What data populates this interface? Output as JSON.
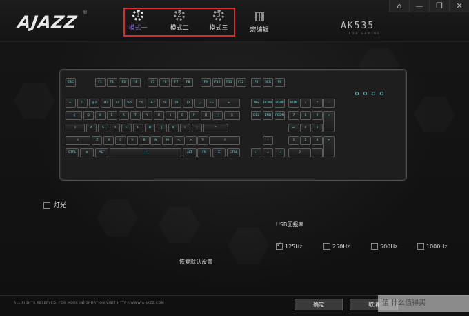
{
  "brand": {
    "logo": "AJAZZ",
    "reg": "®",
    "model": "AK535",
    "model_sub": "FOR GAMING"
  },
  "window_controls": [
    "⌂",
    "—",
    "❐",
    "✕"
  ],
  "modes": [
    {
      "num": "1",
      "label": "模式一",
      "active": true
    },
    {
      "num": "2",
      "label": "模式二",
      "active": false
    },
    {
      "num": "3",
      "label": "模式三",
      "active": false
    }
  ],
  "macro_label": "宏编辑",
  "keyboard": {
    "rows": [
      [
        "ESC",
        "F1",
        "F2",
        "F3",
        "F4",
        "F5",
        "F6",
        "F7",
        "F8",
        "F9",
        "F10",
        "F11",
        "F12",
        "PS",
        "SCR",
        "PB"
      ],
      [
        "~`",
        "!1",
        "@2",
        "#3",
        "$4",
        "%5",
        "^6",
        "&7",
        "*8",
        "(9",
        ")0",
        "_-",
        "+=",
        "←",
        "INS",
        "HOME",
        "PGUP",
        "NUM",
        "/",
        "*",
        "-"
      ],
      [
        "→|",
        "Q",
        "W",
        "E",
        "R",
        "T",
        "Y",
        "U",
        "I",
        "O",
        "P",
        "{[",
        "}]",
        "|\\",
        "DEL",
        "END",
        "PGDN",
        "7",
        "8",
        "9",
        "+"
      ],
      [
        "⇩",
        "A",
        "S",
        "D",
        "F",
        "G",
        "H",
        "J",
        "K",
        "L",
        ":;",
        "\"'",
        "↵",
        "4",
        "5",
        "6"
      ],
      [
        "⇧",
        "Z",
        "X",
        "C",
        "V",
        "B",
        "N",
        "M",
        "<,",
        ">.",
        "?/",
        "⇧",
        "↑",
        "1",
        "2",
        "3",
        "↵"
      ],
      [
        "CTRL",
        "⊞",
        "ALT",
        "━━",
        "ALT",
        "FN",
        "☰",
        "CTRL",
        "←",
        "↓",
        "→",
        "0",
        "."
      ]
    ]
  },
  "light_label": "灯光",
  "usb": {
    "title": "USB回报率",
    "options": [
      {
        "label": "125Hz",
        "checked": true
      },
      {
        "label": "250Hz",
        "checked": false
      },
      {
        "label": "500Hz",
        "checked": false
      },
      {
        "label": "1000Hz",
        "checked": false
      }
    ]
  },
  "reset_label": "恢复默认设置",
  "copyright": "ALL RIGHTS RESERVED. FOR MORE INFORMATION,VISIT HTTP://WWW.A-JAZZ.COM",
  "buttons": {
    "ok": "确定",
    "cancel": "取消"
  },
  "watermark": "值 什么值得买"
}
